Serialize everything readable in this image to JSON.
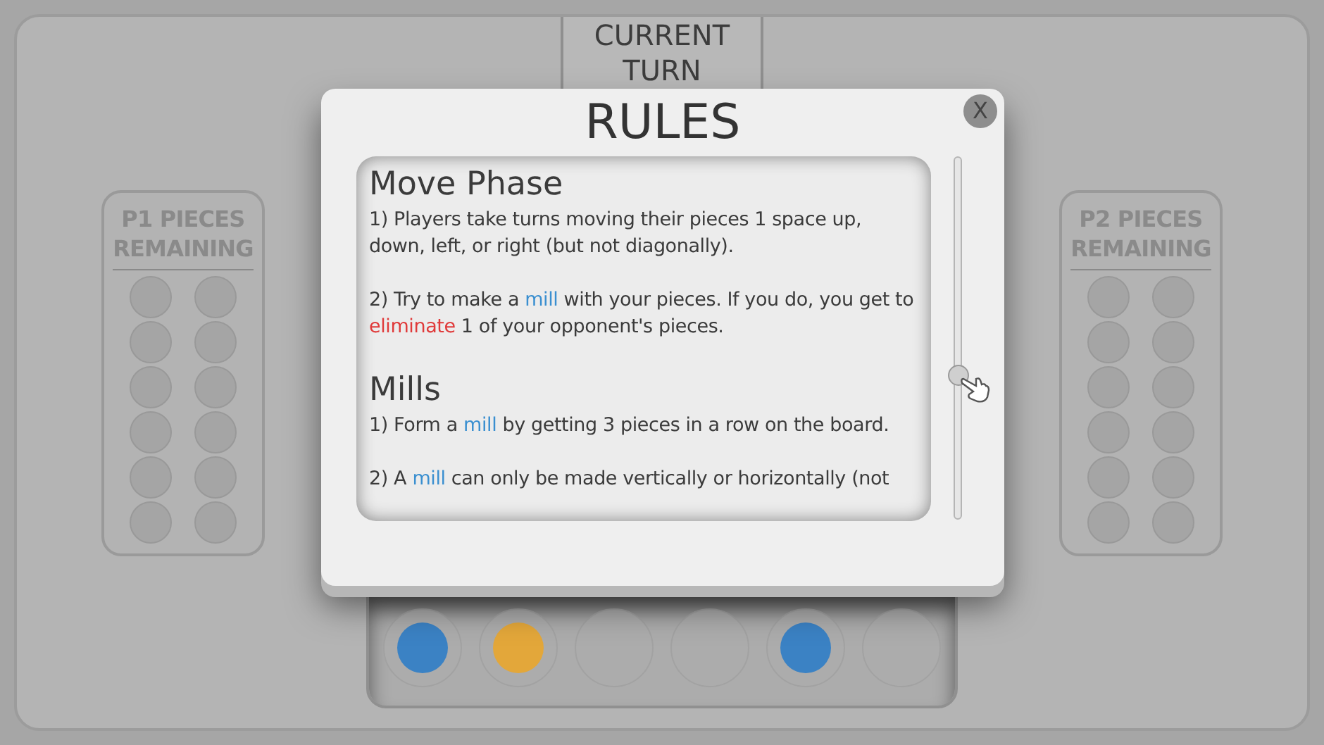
{
  "current_turn": {
    "label": "CURRENT TURN"
  },
  "players": [
    {
      "label": "P1 PIECES REMAINING"
    },
    {
      "label": "P2 PIECES REMAINING"
    }
  ],
  "tray": [
    {
      "filled": true,
      "color": "#3b82c4"
    },
    {
      "filled": true,
      "color": "#e3a73a"
    },
    {
      "filled": false
    },
    {
      "filled": false
    },
    {
      "filled": true,
      "color": "#3b82c4"
    },
    {
      "filled": false
    }
  ],
  "dialog": {
    "title": "RULES",
    "close": "X",
    "sections": [
      {
        "heading": "Move Phase",
        "paragraphs": [
          [
            {
              "kind": "plain",
              "text": "1) Players take turns moving their pieces 1 space up, down, left, or right (but not diagonally)."
            }
          ],
          [
            {
              "kind": "plain",
              "text": "2) Try to make a "
            },
            {
              "kind": "term",
              "text": "mill"
            },
            {
              "kind": "plain",
              "text": " with your pieces. If you do, you get to "
            },
            {
              "kind": "warning",
              "text": "eliminate"
            },
            {
              "kind": "plain",
              "text": " 1 of your opponent's pieces."
            }
          ]
        ]
      },
      {
        "heading": "Mills",
        "paragraphs": [
          [
            {
              "kind": "plain",
              "text": "1) Form a "
            },
            {
              "kind": "term",
              "text": "mill"
            },
            {
              "kind": "plain",
              "text": " by getting 3 pieces in a row on the board."
            }
          ],
          [
            {
              "kind": "plain",
              "text": "2) A "
            },
            {
              "kind": "term",
              "text": "mill"
            },
            {
              "kind": "plain",
              "text": " can only be made vertically or horizontally (not"
            }
          ]
        ]
      }
    ]
  }
}
